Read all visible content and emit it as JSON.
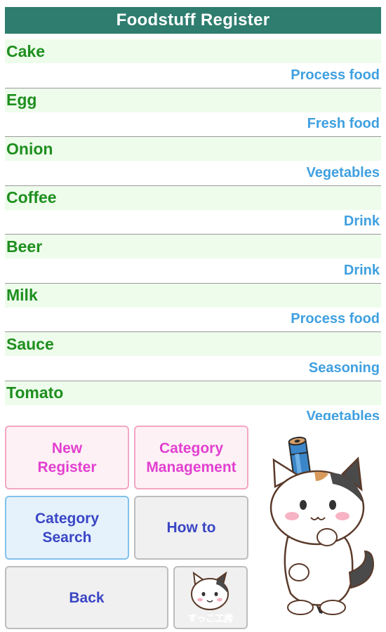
{
  "header": {
    "title": "Foodstuff Register"
  },
  "items": [
    {
      "name": "Cake",
      "category": "Process food"
    },
    {
      "name": "Egg",
      "category": "Fresh food"
    },
    {
      "name": "Onion",
      "category": "Vegetables"
    },
    {
      "name": "Coffee",
      "category": "Drink"
    },
    {
      "name": "Beer",
      "category": "Drink"
    },
    {
      "name": "Milk",
      "category": "Process food"
    },
    {
      "name": "Sauce",
      "category": "Seasoning"
    },
    {
      "name": "Tomato",
      "category": "Vegetables"
    }
  ],
  "buttons": {
    "new_register": "New\nRegister",
    "category_management": "Category\nManagement",
    "category_search": "Category\nSearch",
    "how_to": "How to",
    "back": "Back"
  },
  "logo": {
    "text": "すっこ工房"
  },
  "colors": {
    "header_bg": "#2e7d6f",
    "item_name": "#1e8f1e",
    "item_category": "#3fa0e0",
    "pink_text": "#e23fd0",
    "blue_text": "#3a46c4"
  }
}
